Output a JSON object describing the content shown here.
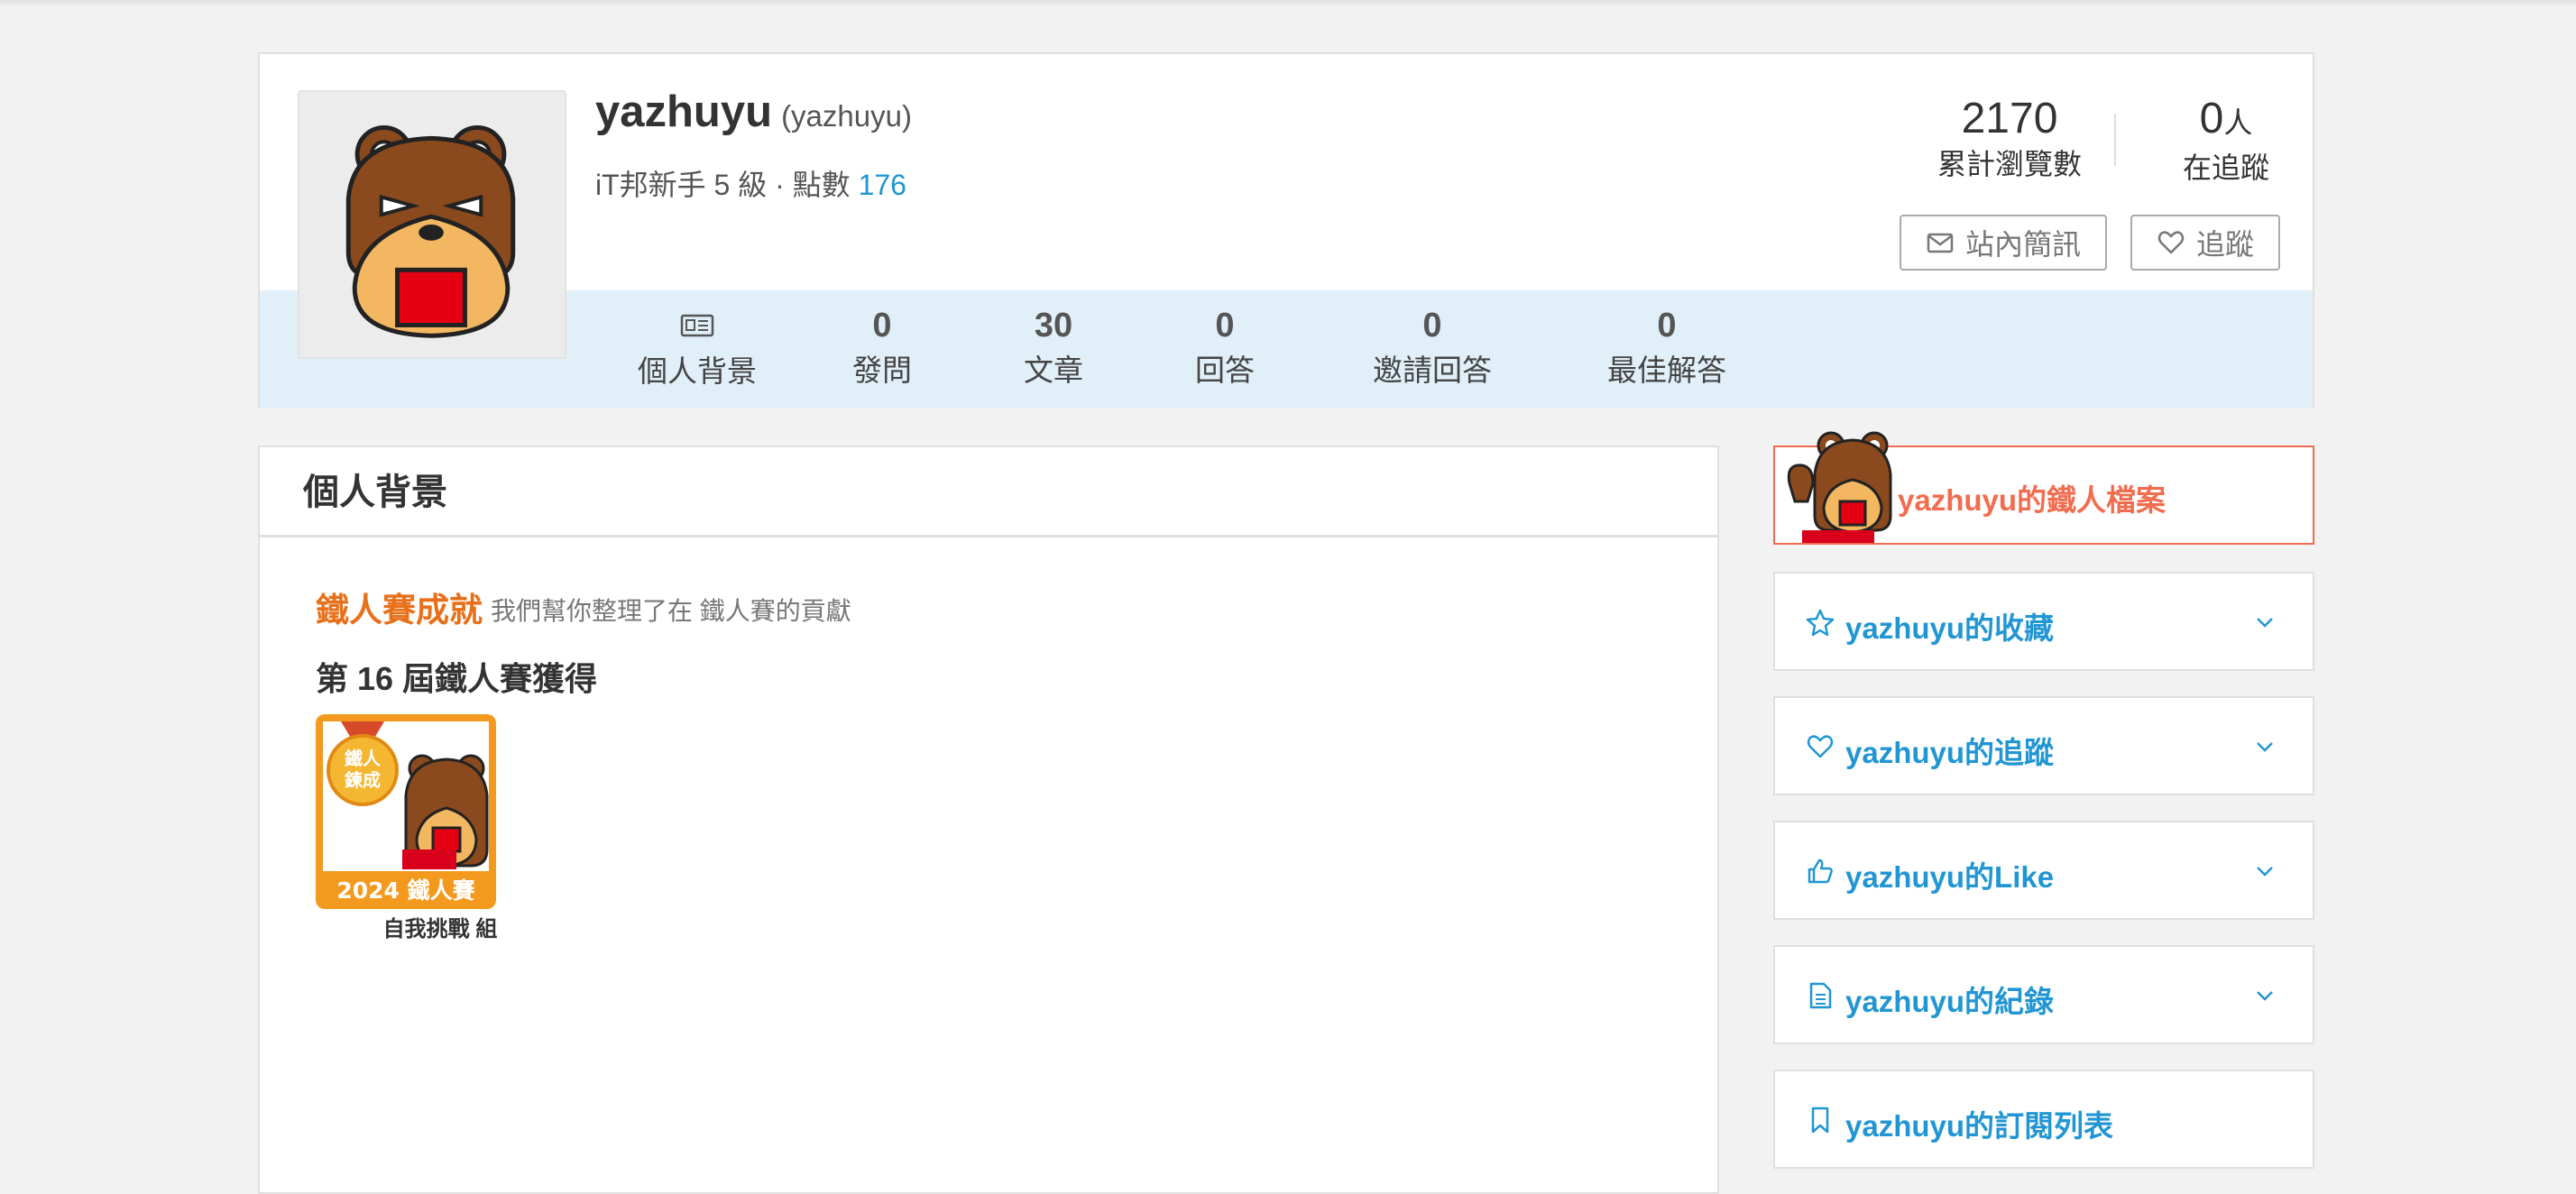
{
  "profile": {
    "username": "yazhuyu",
    "handle": "(yazhuyu)",
    "level_text": "iT邦新手 5 級 · 點數",
    "points": "176",
    "views": {
      "value": "2170",
      "label": "累計瀏覽數"
    },
    "followers": {
      "value": "0",
      "unit": "人",
      "label": "在追蹤"
    },
    "message_button": "站內簡訊",
    "follow_button": "追蹤"
  },
  "tabs": [
    {
      "label": "個人背景",
      "icon": "profile-card-icon"
    },
    {
      "value": "0",
      "label": "發問"
    },
    {
      "value": "30",
      "label": "文章"
    },
    {
      "value": "0",
      "label": "回答"
    },
    {
      "value": "0",
      "label": "邀請回答"
    },
    {
      "value": "0",
      "label": "最佳解答"
    }
  ],
  "main": {
    "header": "個人背景",
    "achievement_title": "鐵人賽成就",
    "achievement_desc": "我們幫你整理了在 鐵人賽的貢獻",
    "season": "第 16 屆鐵人賽獲得",
    "badge": {
      "medal_text_1": "鐵人",
      "medal_text_2": "鍊成",
      "year_label": "2024 鐵人賽",
      "group_label": "自我挑戰 組"
    }
  },
  "sidebar": {
    "ironman_profile": "yazhuyu的鐵人檔案",
    "items": [
      {
        "label": "yazhuyu的收藏",
        "icon": "star-icon",
        "expandable": true
      },
      {
        "label": "yazhuyu的追蹤",
        "icon": "heart-icon",
        "expandable": true
      },
      {
        "label": "yazhuyu的Like",
        "icon": "thumbs-up-icon",
        "expandable": true
      },
      {
        "label": "yazhuyu的紀錄",
        "icon": "document-icon",
        "expandable": true
      },
      {
        "label": "yazhuyu的訂閱列表",
        "icon": "bookmark-icon",
        "expandable": false
      }
    ]
  },
  "colors": {
    "accent_blue": "#2196d3",
    "ironman_red": "#f26c4f",
    "achievement_orange": "#e8701a",
    "stats_band": "#e1eff8"
  }
}
